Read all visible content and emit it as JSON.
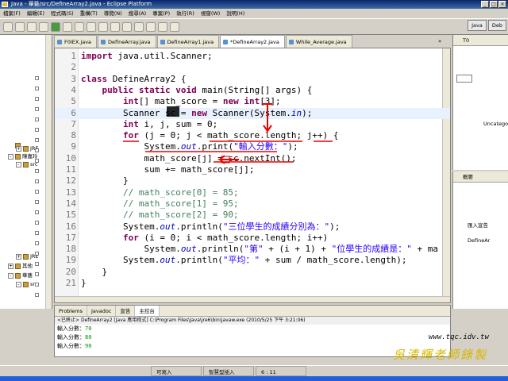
{
  "window": {
    "title": "Java - 華藝/src/DefineArray2.java - Eclipse Platform"
  },
  "menu": [
    "檔案(F)",
    "編輯(E)",
    "程式碼(S)",
    "重構(T)",
    "導覽(N)",
    "搜尋(A)",
    "專案(P)",
    "執行(R)",
    "視窗(W)",
    "說明(H)"
  ],
  "perspectives": [
    "Java",
    "Deb"
  ],
  "tabs": [
    {
      "label": "F0IEX.java",
      "active": false
    },
    {
      "label": "DefineArray.java",
      "active": false
    },
    {
      "label": "DefineArray1.java",
      "active": false
    },
    {
      "label": "*DefineArray2.java",
      "active": true
    },
    {
      "label": "While_Average.java",
      "active": false
    }
  ],
  "tabs_more": "»",
  "tree": [
    {
      "label": "...",
      "indent": 0,
      "exp": ""
    },
    {
      "label": "JRE",
      "indent": 2,
      "exp": "+"
    },
    {
      "label": "陳嘉玲",
      "indent": 0,
      "exp": "-"
    },
    {
      "label": "src",
      "indent": 2,
      "exp": "-"
    },
    {
      "label": "JRE",
      "indent": 2,
      "exp": "+"
    },
    {
      "label": "其他",
      "indent": 0,
      "exp": "+"
    },
    {
      "label": "華藝",
      "indent": 0,
      "exp": "-"
    },
    {
      "label": "src",
      "indent": 2,
      "exp": "-"
    }
  ],
  "code": [
    {
      "n": "1",
      "tokens": [
        [
          "kw",
          "import"
        ],
        [
          "",
          " java.util.Scanner;"
        ]
      ]
    },
    {
      "n": "2",
      "tokens": []
    },
    {
      "n": "3",
      "tokens": [
        [
          "kw",
          "class"
        ],
        [
          "",
          " DefineArray2 {"
        ]
      ]
    },
    {
      "n": "4",
      "tokens": [
        [
          "",
          "    "
        ],
        [
          "kw",
          "public static void"
        ],
        [
          "",
          " main(String[] args) {"
        ]
      ]
    },
    {
      "n": "5",
      "tokens": [
        [
          "",
          "        "
        ],
        [
          "kw",
          "int"
        ],
        [
          "",
          "[] math_score = "
        ],
        [
          "kw",
          "new int"
        ],
        [
          "",
          "[3];"
        ]
      ]
    },
    {
      "n": "6",
      "tokens": [
        [
          "",
          "        Scanner sc = "
        ],
        [
          "kw",
          "new"
        ],
        [
          "",
          " Scanner(System."
        ],
        [
          "fld",
          "in"
        ],
        [
          "",
          ");"
        ]
      ]
    },
    {
      "n": "7",
      "tokens": [
        [
          "",
          "        "
        ],
        [
          "kw",
          "int"
        ],
        [
          "",
          " i, j, sum = 0;"
        ]
      ]
    },
    {
      "n": "8",
      "tokens": [
        [
          "",
          "        "
        ],
        [
          "kw",
          "for"
        ],
        [
          "",
          " (j = 0; j < math_score.length; j++) {"
        ]
      ]
    },
    {
      "n": "9",
      "tokens": [
        [
          "",
          "            System."
        ],
        [
          "fld",
          "out"
        ],
        [
          "",
          ".print("
        ],
        [
          "str",
          "\"輸入分數：\""
        ],
        [
          "",
          ");"
        ]
      ]
    },
    {
      "n": "10",
      "tokens": [
        [
          "",
          "            math_score[j] = sc.nextInt();"
        ]
      ]
    },
    {
      "n": "11",
      "tokens": [
        [
          "",
          "            sum += math_score[j];"
        ]
      ]
    },
    {
      "n": "12",
      "tokens": [
        [
          "",
          "        }"
        ]
      ]
    },
    {
      "n": "13",
      "tokens": [
        [
          "cmt",
          "        // math_score[0] = 85;"
        ]
      ]
    },
    {
      "n": "14",
      "tokens": [
        [
          "cmt",
          "        // math_score[1] = 95;"
        ]
      ]
    },
    {
      "n": "15",
      "tokens": [
        [
          "cmt",
          "        // math_score[2] = 90;"
        ]
      ]
    },
    {
      "n": "16",
      "tokens": [
        [
          "",
          "        System."
        ],
        [
          "fld",
          "out"
        ],
        [
          "",
          ".println("
        ],
        [
          "str",
          "\"三位學生的成績分別為：\""
        ],
        [
          "",
          ");"
        ]
      ]
    },
    {
      "n": "17",
      "tokens": [
        [
          "",
          "        "
        ],
        [
          "kw",
          "for"
        ],
        [
          "",
          " (i = 0; i < math_score.length; i++)"
        ]
      ]
    },
    {
      "n": "18",
      "tokens": [
        [
          "",
          "            System."
        ],
        [
          "fld",
          "out"
        ],
        [
          "",
          ".println("
        ],
        [
          "str",
          "\"第\""
        ],
        [
          "",
          " + (i + 1) + "
        ],
        [
          "str",
          "\"位學生的成績是：\""
        ],
        [
          "",
          " + ma"
        ]
      ]
    },
    {
      "n": "19",
      "tokens": [
        [
          "",
          "        System."
        ],
        [
          "fld",
          "out"
        ],
        [
          "",
          ".println("
        ],
        [
          "str",
          "\"平均：\""
        ],
        [
          "",
          " + sum / math_score.length);"
        ]
      ]
    },
    {
      "n": "20",
      "tokens": [
        [
          "",
          "    }"
        ]
      ]
    },
    {
      "n": "21",
      "tokens": [
        [
          "",
          "}"
        ]
      ]
    }
  ],
  "right_top": {
    "title": "T0",
    "label": "Uncatego"
  },
  "right_bottom": {
    "title": "概要",
    "items": [
      "匯入宣告",
      "DefineAr"
    ]
  },
  "console": {
    "tabs": [
      "Problems",
      "Javadoc",
      "宣告",
      "主控台"
    ],
    "header": "<已終止> DefineArray2 [Java 應用程式] C:\\Program Files\\Java\\jre6\\bin\\javaw.exe (2010/5/25 下午 3:21:06)",
    "lines": [
      {
        "prompt": "輸入分數：",
        "value": "70"
      },
      {
        "prompt": "輸入分數：",
        "value": "80"
      },
      {
        "prompt": "輸入分數：",
        "value": "90"
      }
    ]
  },
  "watermark": {
    "site": "www.tqc.idv.tw",
    "teacher": "吳清輝老師錄製"
  },
  "status": [
    "可寫入",
    "智慧型插入",
    "6 : 11"
  ]
}
